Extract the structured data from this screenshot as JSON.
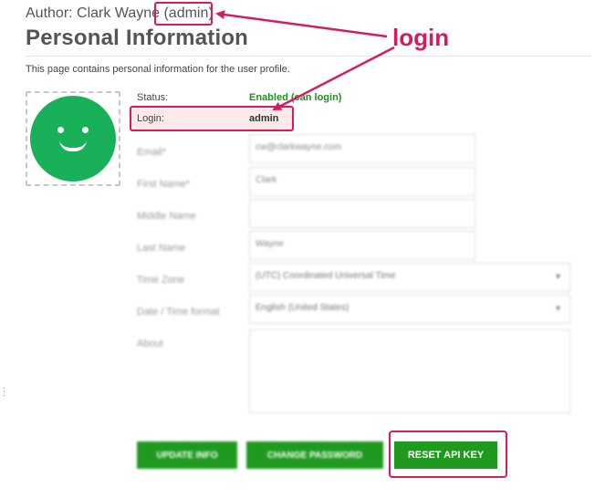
{
  "header": {
    "author_prefix": "Author: Clark Wayne",
    "author_role": "(admin)",
    "title": "Personal Information",
    "description": "This page contains personal information for the user profile."
  },
  "profile": {
    "status_label": "Status:",
    "status_value": "Enabled (can login)",
    "login_label": "Login:",
    "login_value": "admin"
  },
  "form": {
    "fields": [
      {
        "label": "Email*",
        "value": "cw@clarkwayne.com"
      },
      {
        "label": "First Name*",
        "value": "Clark"
      },
      {
        "label": "Middle Name",
        "value": ""
      },
      {
        "label": "Last Name",
        "value": "Wayne"
      },
      {
        "label": "Time Zone",
        "value": "(UTC) Coordinated Universal Time"
      },
      {
        "label": "Date / Time format",
        "value": "English (United States)"
      },
      {
        "label": "About",
        "value": ""
      }
    ]
  },
  "buttons": {
    "update": "Update Info",
    "change_password": "Change Password",
    "reset_api": "RESET API KEY"
  },
  "annotation": {
    "text": "login",
    "color": "#d81b60"
  },
  "colors": {
    "accent_green": "#1f9a1f",
    "avatar_green": "#18b15a",
    "status_green": "#1e8f1e"
  }
}
